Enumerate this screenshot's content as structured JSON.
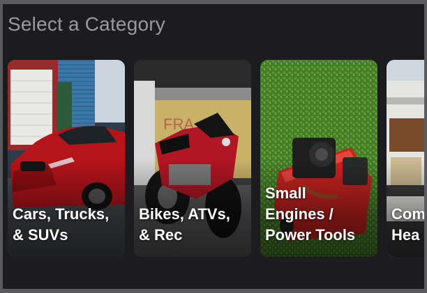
{
  "section": {
    "title": "Select a Category"
  },
  "categories": [
    {
      "label": "Cars, Trucks,\n& SUVs"
    },
    {
      "label": "Bikes, ATVs,\n& Rec"
    },
    {
      "label": "Small\nEngines /\nPower Tools"
    },
    {
      "label": "Com\nHea"
    }
  ]
}
